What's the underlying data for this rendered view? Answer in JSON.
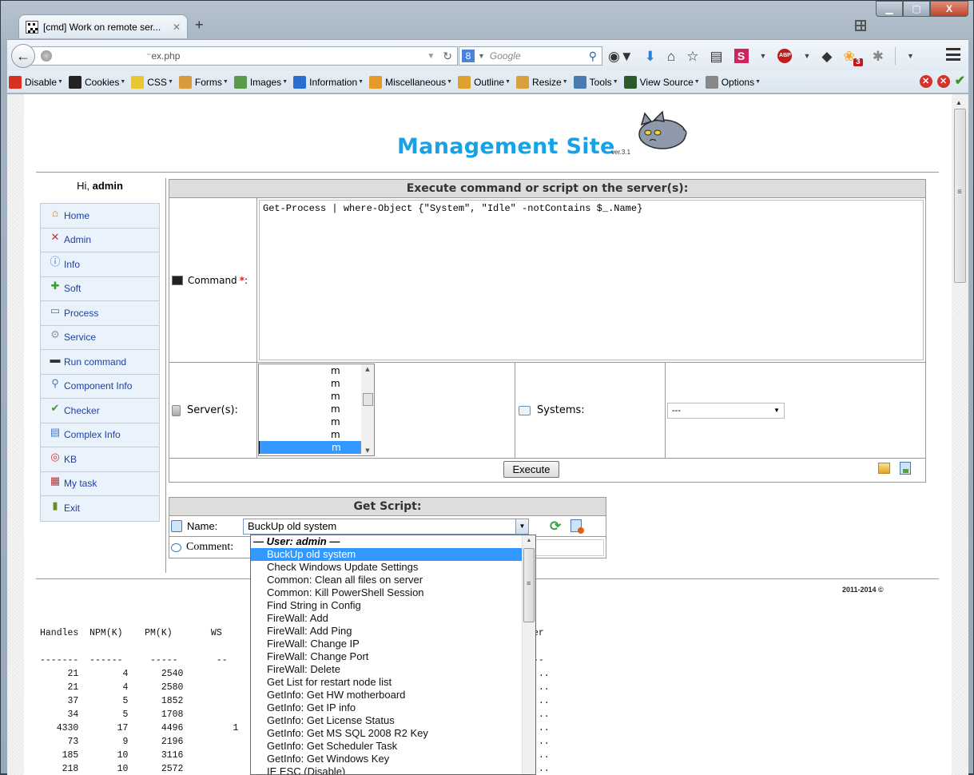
{
  "browser": {
    "tab_title": "[cmd] Work on remote ser...",
    "tab_close": "✕",
    "new_tab": "+",
    "url": "⁻ex.php",
    "search_placeholder": "Google",
    "search_engine_letter": "8",
    "addon_badge": "3",
    "window_buttons": {
      "minimize": "▁",
      "maximize": "▢",
      "close": "X"
    }
  },
  "webdev_toolbar": {
    "items": [
      {
        "label": "Disable",
        "icon": "disable-icon",
        "color": "#d9301f"
      },
      {
        "label": "Cookies",
        "icon": "cookies-icon",
        "color": "#222222"
      },
      {
        "label": "CSS",
        "icon": "css-icon",
        "color": "#e8c631"
      },
      {
        "label": "Forms",
        "icon": "forms-icon",
        "color": "#d99a3a"
      },
      {
        "label": "Images",
        "icon": "images-icon",
        "color": "#5a9a4a"
      },
      {
        "label": "Information",
        "icon": "information-icon",
        "color": "#2a6fd0"
      },
      {
        "label": "Miscellaneous",
        "icon": "miscellaneous-icon",
        "color": "#e39a2a"
      },
      {
        "label": "Outline",
        "icon": "outline-icon",
        "color": "#e0a030"
      },
      {
        "label": "Resize",
        "icon": "resize-icon",
        "color": "#d9a040"
      },
      {
        "label": "Tools",
        "icon": "tools-icon",
        "color": "#4a7ab0"
      },
      {
        "label": "View Source",
        "icon": "view-source-icon",
        "color": "#2d5a2d"
      },
      {
        "label": "Options",
        "icon": "options-icon",
        "color": "#888888"
      }
    ]
  },
  "site": {
    "title": "Management Site",
    "version": "ver.3.1",
    "greeting": "Hi,",
    "username": "admin",
    "accent": "#15a3e8"
  },
  "sidebar": {
    "items": [
      {
        "label": "Home",
        "icon": "⌂"
      },
      {
        "label": "Admin",
        "icon": "✕"
      },
      {
        "label": "Info",
        "icon": "ⓘ"
      },
      {
        "label": "Soft",
        "icon": "✚"
      },
      {
        "label": "Process",
        "icon": "▭"
      },
      {
        "label": "Service",
        "icon": "⚙"
      },
      {
        "label": "Run command",
        "icon": "▬"
      },
      {
        "label": "Component Info",
        "icon": "⚲"
      },
      {
        "label": "Checker",
        "icon": "✔"
      },
      {
        "label": "Complex Info",
        "icon": "▤"
      },
      {
        "label": "KB",
        "icon": "◎"
      },
      {
        "label": "My task",
        "icon": "▦"
      },
      {
        "label": "Exit",
        "icon": "▮"
      }
    ]
  },
  "execute": {
    "heading": "Execute command or script on the server(s):",
    "command_label": "Command",
    "required_mark": "*",
    "command_label_suffix": ":",
    "command_value": "Get-Process | where-Object {\"System\", \"Idle\" -notContains $_.Name}",
    "servers_label": "Server(s):",
    "servers": [
      "m",
      "m",
      "m",
      "m",
      "m",
      "m",
      "m"
    ],
    "servers_selected_index": 6,
    "systems_label": "Systems:",
    "systems_value": "---",
    "execute_button": "Execute"
  },
  "get_script": {
    "heading": "Get Script:",
    "name_label": "Name:",
    "name_value": "BuckUp old system",
    "comment_label": "Comment:",
    "comment_value": "",
    "dropdown_group": "— User: admin —",
    "options": [
      "BuckUp old system",
      "Check Windows Update Settings",
      "Common: Clean all files on server",
      "Common: Kill PowerShell Session",
      "Find String in Config",
      "FireWall: Add",
      "FireWall: Add Ping",
      "FireWall: Change IP",
      "FireWall: Change Port",
      "FireWall: Delete",
      "Get List for restart node list",
      "GetInfo: Get HW motherboard",
      "GetInfo: Get IP info",
      "GetInfo: Get License Status",
      "GetInfo: Get MS SQL 2008 R2 Key",
      "GetInfo: Get Scheduler Task",
      "GetInfo: Get Windows Key",
      "IE ESC (Disable)"
    ],
    "selected_index": 0
  },
  "footer": {
    "copyright": "2011-2014 ©"
  },
  "output": {
    "headers": [
      "Handles",
      "NPM(K)",
      "PM(K)",
      "WS"
    ],
    "trailing_header": "er",
    "rows": [
      [
        "21",
        "4",
        "2540",
        ""
      ],
      [
        "21",
        "4",
        "2580",
        ""
      ],
      [
        "37",
        "5",
        "1852",
        ""
      ],
      [
        "34",
        "5",
        "1708",
        ""
      ],
      [
        "4330",
        "17",
        "4496",
        "1"
      ],
      [
        "73",
        "9",
        "2196",
        ""
      ],
      [
        "185",
        "10",
        "3116",
        ""
      ],
      [
        "218",
        "10",
        "2572",
        ""
      ]
    ]
  }
}
